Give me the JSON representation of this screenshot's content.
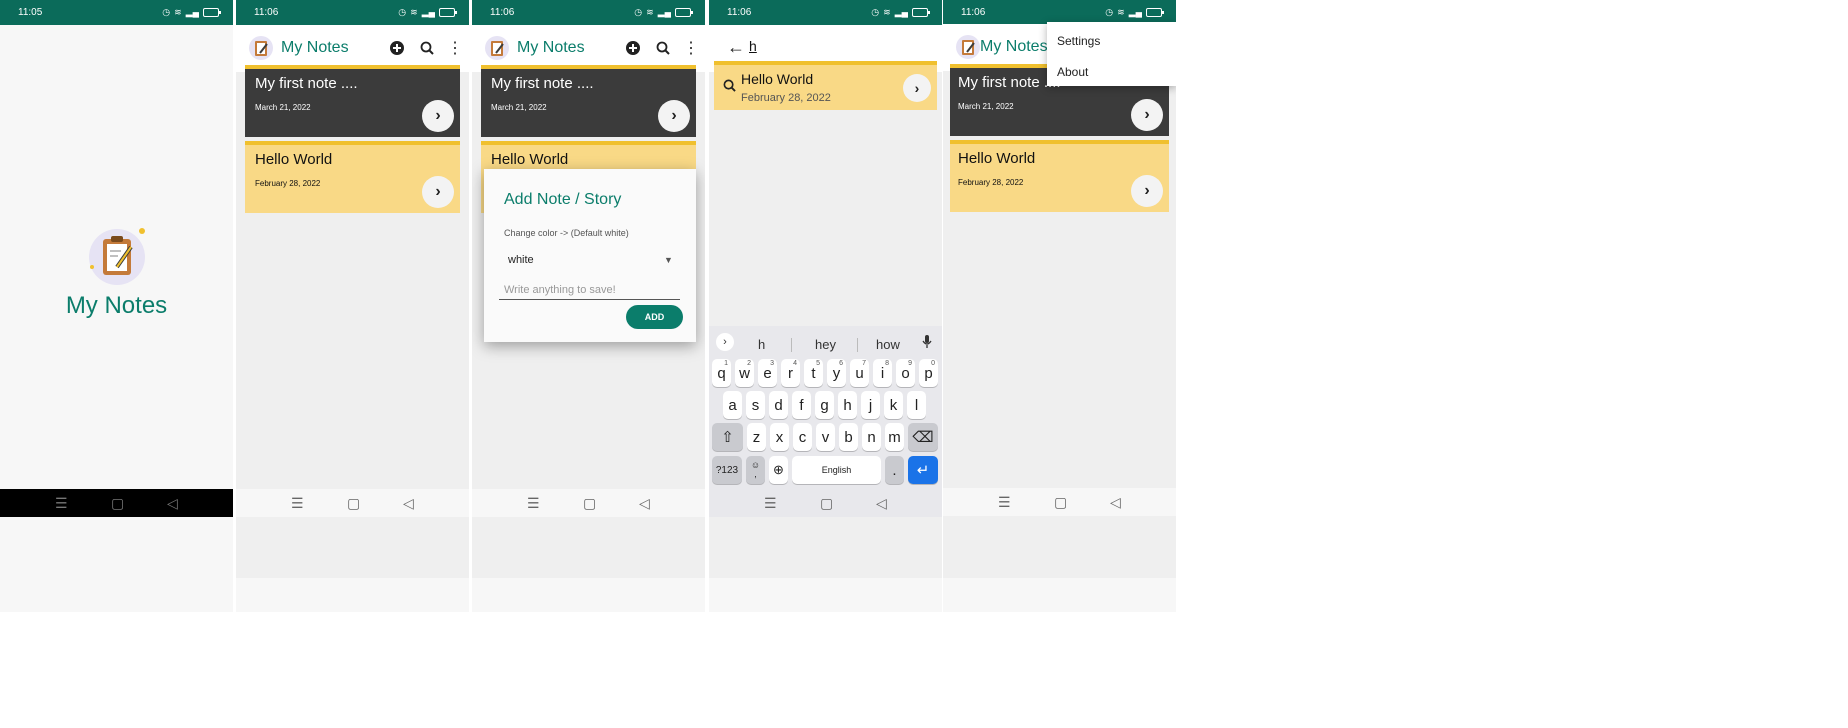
{
  "colors": {
    "accent": "#0b7d6b",
    "statusbar": "#0b6b5a",
    "note_dark": "#3b3b3b",
    "note_yellow": "#f9d986",
    "note_border": "#f0c02e",
    "keyboard_blue": "#1a73e8"
  },
  "status": {
    "time_1": "11:05",
    "time_2": "11:06",
    "time_3": "11:06",
    "time_4": "11:06",
    "time_5": "11:06"
  },
  "app": {
    "title": "My Notes"
  },
  "icons": {
    "logo": "clipboard-pencil-icon",
    "add": "add-circle-icon",
    "search": "search-icon",
    "overflow": "more-vert-icon",
    "arrow": "chevron-right-icon",
    "back": "arrow-back-icon",
    "mic": "mic-icon",
    "shift": "shift-icon",
    "backspace": "backspace-icon",
    "globe": "globe-icon",
    "enter": "enter-icon",
    "emoji": "emoji-icon"
  },
  "notes": [
    {
      "title": "My first note ....",
      "date": "March 21, 2022"
    },
    {
      "title": "Hello World",
      "date": "February 28, 2022"
    }
  ],
  "dialog": {
    "title": "Add Note / Story",
    "subtitle": "Change color -> (Default white)",
    "selected": "white",
    "placeholder": "Write anything to save!",
    "add_label": "ADD"
  },
  "search": {
    "query": "h",
    "result_title": "Hello World",
    "result_date": "February 28, 2022",
    "suggestions": [
      "h",
      "hey",
      "how"
    ]
  },
  "keyboard": {
    "row1": [
      "q",
      "w",
      "e",
      "r",
      "t",
      "y",
      "u",
      "i",
      "o",
      "p"
    ],
    "row1_hints": [
      "1",
      "2",
      "3",
      "4",
      "5",
      "6",
      "7",
      "8",
      "9",
      "0"
    ],
    "row2": [
      "a",
      "s",
      "d",
      "f",
      "g",
      "h",
      "j",
      "k",
      "l"
    ],
    "row3": [
      "z",
      "x",
      "c",
      "v",
      "b",
      "n",
      "m"
    ],
    "sym": "?123",
    "emoji_comma": ",",
    "space": "English",
    "period": "."
  },
  "menu": {
    "items": [
      "Settings",
      "About"
    ]
  }
}
